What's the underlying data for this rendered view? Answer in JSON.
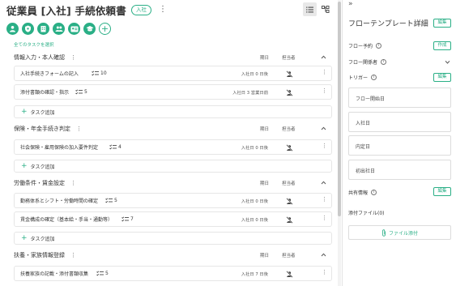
{
  "header": {
    "title": "従業員 [入社] 手続依頼書",
    "badge": "入社",
    "more": "⋮"
  },
  "select_all": "全てのタスクを選択",
  "column_headers": {
    "due": "期日",
    "owner": "担当者"
  },
  "add_task_label": "タスク追加",
  "sections": [
    {
      "title": "情報入力・本人確認",
      "tasks": [
        {
          "name": "入社手続きフォームの記入",
          "count": "10",
          "due": "入社日 0 日後"
        },
        {
          "name": "添付書類の確認・指示",
          "count": "5",
          "due": "入社日 3 営業日前"
        }
      ]
    },
    {
      "title": "保険・年金手続き判定",
      "tasks": [
        {
          "name": "社会保険・雇用保険の加入要件判定",
          "count": "4",
          "due": "入社日 0 日後"
        }
      ]
    },
    {
      "title": "労働条件・賃金設定",
      "tasks": [
        {
          "name": "勤務体系とシフト・労働時間の確定",
          "count": "5",
          "due": "入社日 0 日後"
        },
        {
          "name": "賃金構成の確定（基本給・手当・通勤等）",
          "count": "7",
          "due": "入社日 0 日後"
        }
      ]
    },
    {
      "title": "扶養・家族情報登録",
      "tasks": [
        {
          "name": "扶養家族の記載・添付書類収集",
          "count": "5",
          "due": "入社日 7 日後"
        }
      ]
    }
  ],
  "panel": {
    "collapse": "»",
    "title": "フローテンプレート詳細",
    "edit_label": "編集",
    "flow_reserve_label": "フロー予約",
    "create_label": "作成",
    "flow_members_label": "フロー関係者",
    "trigger_label": "トリガー",
    "triggers": [
      "フロー開始日",
      "入社日",
      "内定日",
      "初出社日"
    ],
    "shared_info_label": "共有情報",
    "attachments_label": "添付ファイル(0)",
    "attach_button": "ファイル添付"
  },
  "colors": {
    "accent": "#2aaf86",
    "border": "#e6e6e6",
    "text": "#333333"
  },
  "icons": {
    "toolbar": [
      "person-icon",
      "shield-icon",
      "building-icon",
      "people-icon",
      "id-card-icon",
      "graduation-icon",
      "plus-icon"
    ],
    "view": [
      "list-view-icon",
      "flow-view-icon"
    ]
  }
}
